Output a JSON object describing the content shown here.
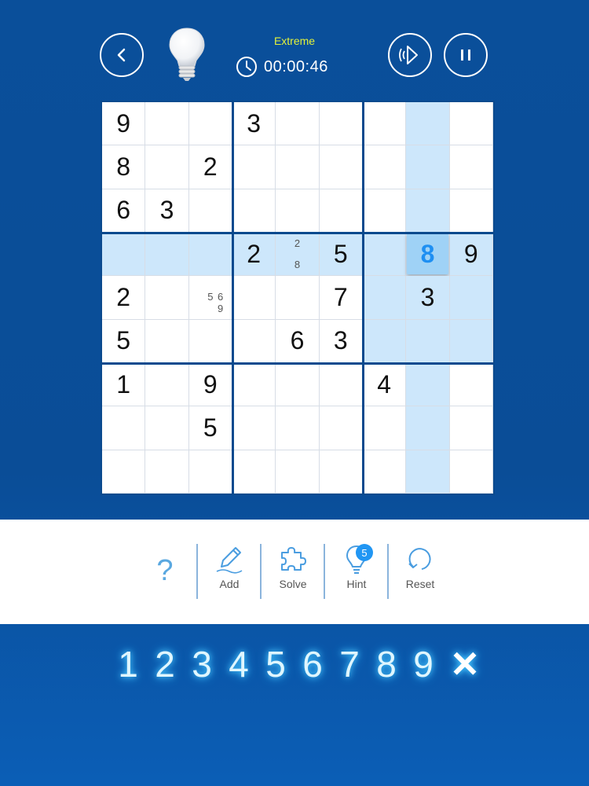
{
  "header": {
    "difficulty": "Extreme",
    "timer": "00:00:46"
  },
  "board": {
    "values": [
      [
        "9",
        "",
        "",
        "3",
        "",
        "",
        "",
        "",
        ""
      ],
      [
        "8",
        "",
        "2",
        "",
        "",
        "",
        "",
        "",
        ""
      ],
      [
        "6",
        "3",
        "",
        "",
        "",
        "",
        "",
        "",
        ""
      ],
      [
        "",
        "",
        "",
        "2",
        "",
        "5",
        "",
        "8",
        "9"
      ],
      [
        "2",
        "",
        "",
        "",
        "",
        "7",
        "",
        "3",
        ""
      ],
      [
        "5",
        "",
        "",
        "",
        "6",
        "3",
        "",
        "",
        ""
      ],
      [
        "1",
        "",
        "9",
        "",
        "",
        "",
        "4",
        "",
        ""
      ],
      [
        "",
        "",
        "5",
        "",
        "",
        "",
        "",
        "",
        ""
      ],
      [
        "",
        "",
        "",
        "",
        "",
        "",
        "",
        "",
        ""
      ]
    ],
    "selected_cell": {
      "row": 3,
      "col": 7,
      "value": "8"
    },
    "notes": [
      {
        "row": 3,
        "col": 4,
        "digits": [
          "2",
          "8"
        ]
      },
      {
        "row": 4,
        "col": 2,
        "digits": [
          "5",
          "6",
          "9"
        ]
      }
    ]
  },
  "toolbar": {
    "help_label": "?",
    "add_label": "Add",
    "solve_label": "Solve",
    "hint_label": "Hint",
    "hint_count": "5",
    "reset_label": "Reset"
  },
  "numpad": {
    "digits": [
      "1",
      "2",
      "3",
      "4",
      "5",
      "6",
      "7",
      "8",
      "9"
    ],
    "clear_label": "✕"
  },
  "colors": {
    "background": "#0a4f9a",
    "difficulty": "#e3f23a",
    "highlight": "#cde7fb",
    "selected_tile": "#9fd2f6",
    "selected_digit": "#1e8ff2",
    "hint_badge": "#2196f3",
    "numpad_glow": "#4fd1ff"
  },
  "icons": {
    "back": "chevron-left-icon",
    "logo": "lightbulb-icon",
    "timer": "clock-icon",
    "sound": "speaker-icon",
    "pause": "pause-icon",
    "add": "pencil-icon",
    "solve": "puzzle-icon",
    "hint": "lightbulb-icon",
    "reset": "reset-icon"
  }
}
